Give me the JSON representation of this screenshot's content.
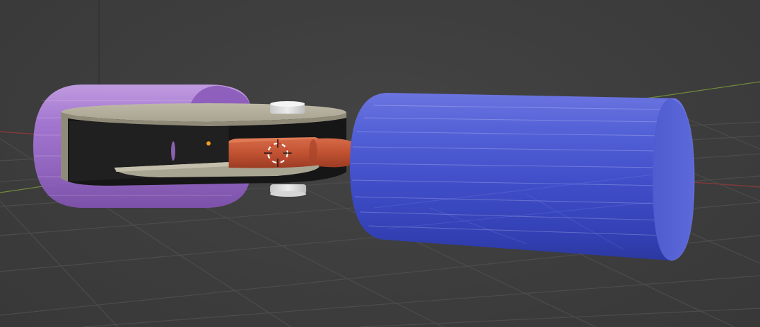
{
  "viewport": {
    "type": "3d-viewport",
    "background_color": "#3d3d3d",
    "grid_color": "#4c4c4c",
    "x_axis_color": "#8a3a3a",
    "y_axis_color": "#7a9a3a",
    "z_axis_color": "#3a3a3a"
  },
  "objects": [
    {
      "name": "purple-cylinder",
      "color": "#9a6cc8"
    },
    {
      "name": "disc-housing",
      "color": "#b8b3a0"
    },
    {
      "name": "top-peg",
      "color": "#d8d8d8"
    },
    {
      "name": "bottom-peg",
      "color": "#c8c8c8"
    },
    {
      "name": "red-connector",
      "color": "#c05030"
    },
    {
      "name": "blue-cylinder",
      "color": "#4a56c8"
    }
  ],
  "cursor": {
    "name": "3d-cursor",
    "colors": [
      "#d94030",
      "#ffffff"
    ]
  },
  "origin_point": {
    "color": "#f0a020"
  }
}
